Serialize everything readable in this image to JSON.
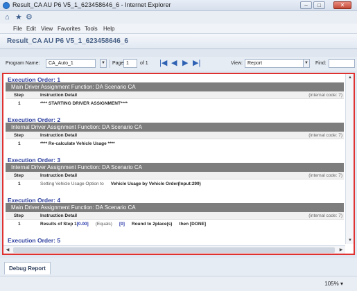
{
  "window": {
    "title": "Result_CA AU P6 V5_1_623458646_6 - Internet Explorer",
    "min_label": "–",
    "max_label": "□",
    "close_label": "✕"
  },
  "nav_icons": {
    "home": "⌂",
    "favorites": "★",
    "tools": "⚙"
  },
  "menu": [
    "File",
    "Edit",
    "View",
    "Favorites",
    "Tools",
    "Help"
  ],
  "page_title": "Result_CA AU P6 V5_1_623458646_6",
  "toolbar": {
    "program_label": "Program Name:",
    "program_value": "CA_Auto_1",
    "page_label": "Page",
    "page_value": "1",
    "of_label": "of 1",
    "view_label": "View:",
    "view_value": "Report",
    "find_label": "Find:",
    "find_value": "",
    "first": "|◀",
    "prev": "◀",
    "next": "▶",
    "last": "▶|",
    "dropdown_arrow": "▼"
  },
  "columns": {
    "step": "Step",
    "instruction": "Instruction Detail",
    "internal": "(internal code: 7)"
  },
  "blocks": [
    {
      "order": "Execution Order: 1",
      "function": "Main Driver Assignment Function: DA Scenario CA",
      "rows": [
        {
          "step": "1",
          "text": "**** STARTING DRIVER ASSIGNMENT****"
        }
      ]
    },
    {
      "order": "Execution Order: 2",
      "function": "Internal Driver Assignment Function: DA Scenario CA",
      "rows": [
        {
          "step": "1",
          "text": "**** Re-calculate Vehicle Usage ****"
        }
      ]
    },
    {
      "order": "Execution Order: 3",
      "function": "Internal Driver Assignment Function: DA Scenario CA",
      "rows": [
        {
          "step": "1",
          "text_light": "Setting Vehicle Usage Option to",
          "text_bold": "Vehicle Usage by Vehicle Order(Input:299)"
        }
      ]
    },
    {
      "order": "Execution Order: 4",
      "function": "Main Driver Assignment Function: DA Scenario CA",
      "rows": [
        {
          "step": "1",
          "p1": "Results of Step 1",
          "p2": "[0.00]",
          "p3": "(Equals)",
          "p4": "[0]",
          "p5": "Round to 2place(s)",
          "p6": "then [DONE]"
        }
      ]
    },
    {
      "order": "Execution Order: 5"
    }
  ],
  "scroll": {
    "up": "▲",
    "down": "▼",
    "left": "◀",
    "right": "▶"
  },
  "bottom_tab": "Debug Report",
  "status": {
    "zoom": "105%",
    "zoom_arrow": "▾"
  }
}
